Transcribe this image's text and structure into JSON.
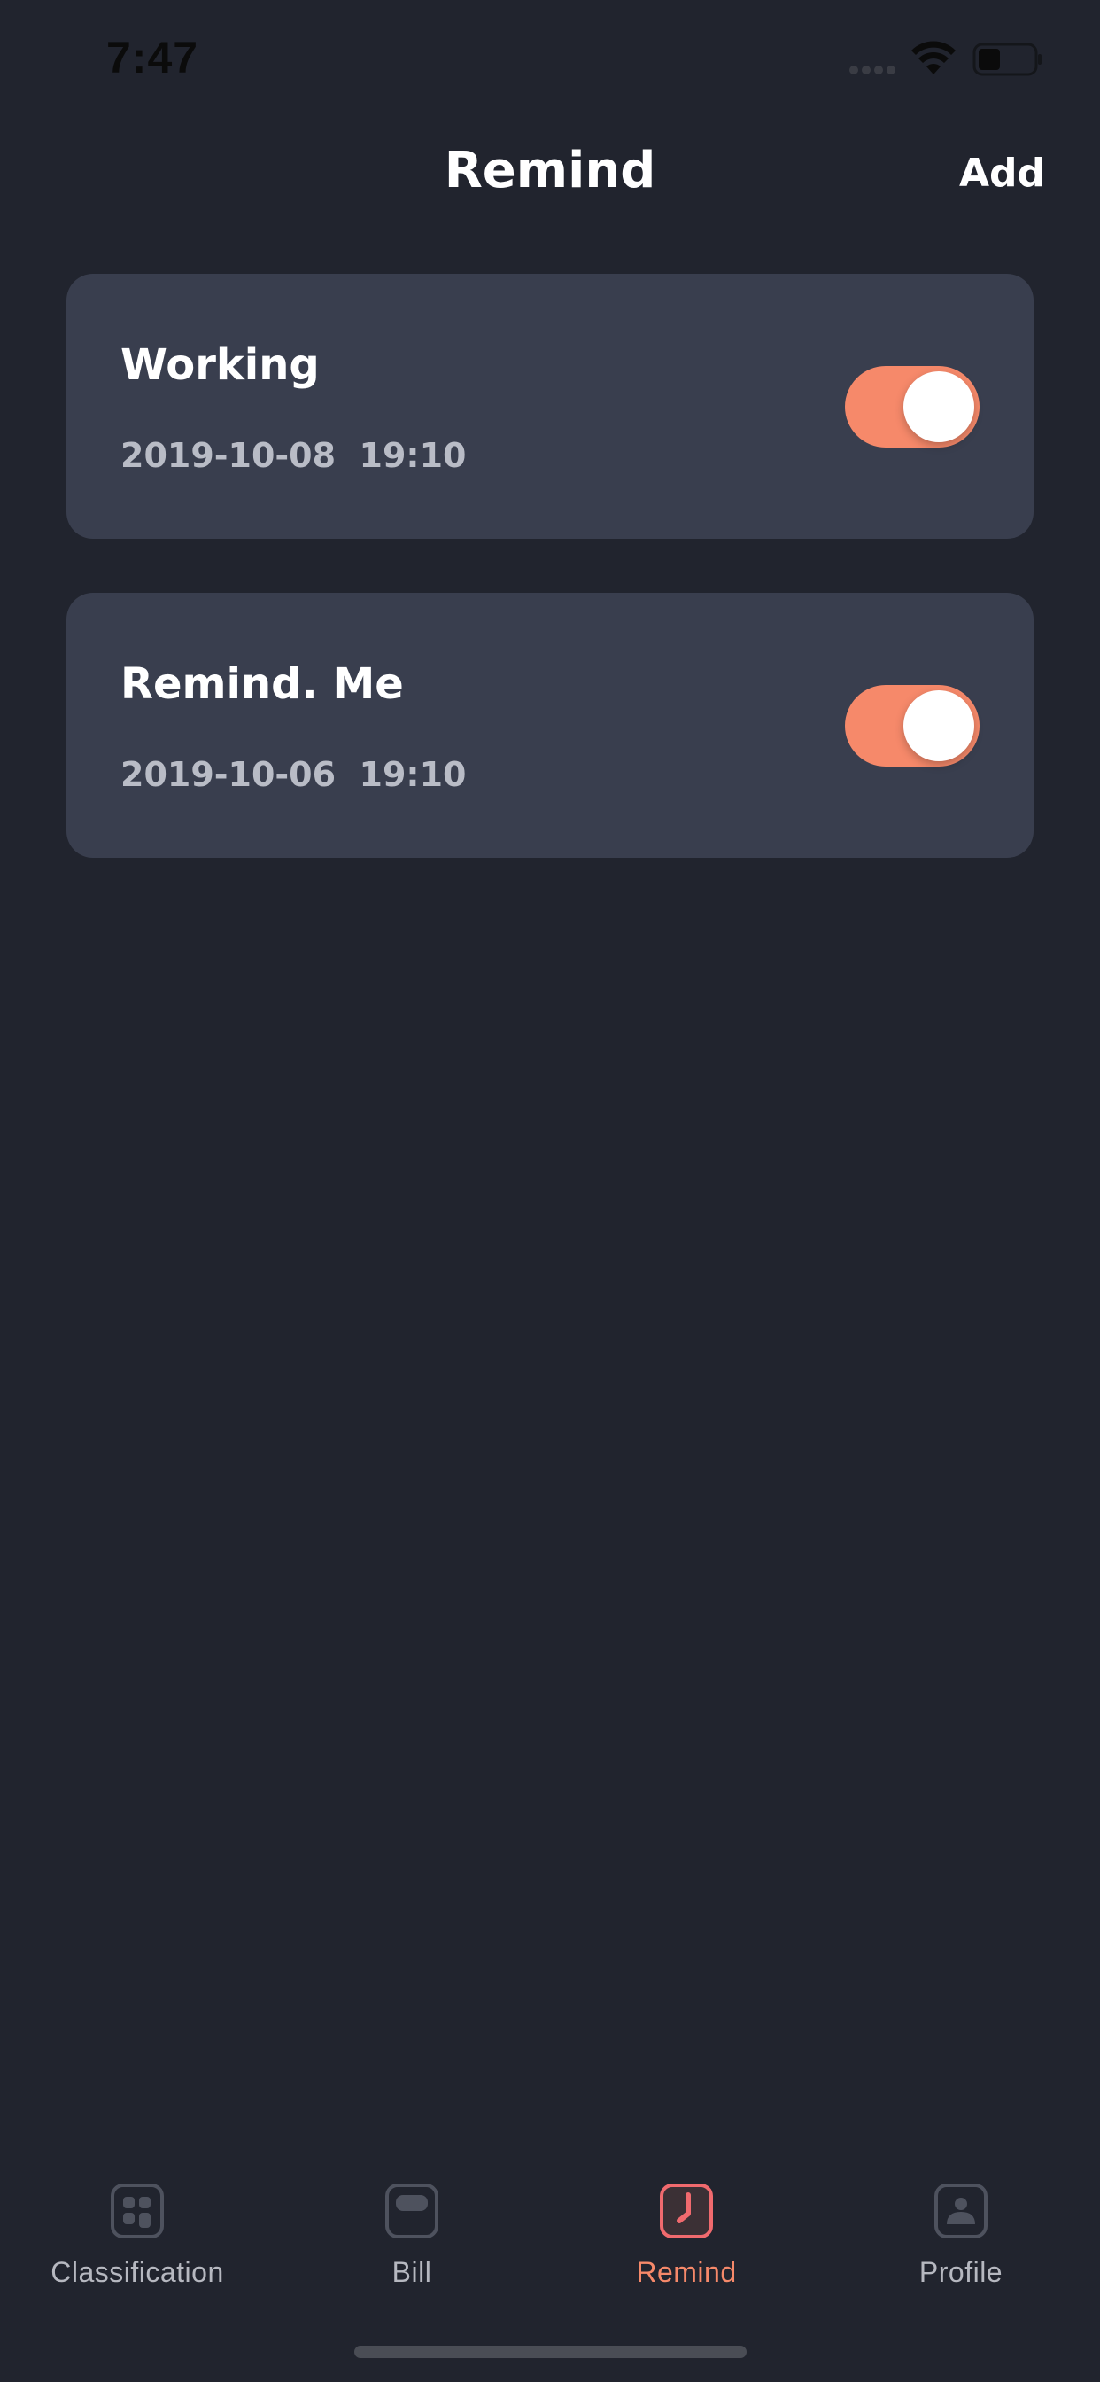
{
  "status_bar": {
    "time": "7:47"
  },
  "header": {
    "title": "Remind",
    "add_label": "Add"
  },
  "reminders": [
    {
      "title": "Working",
      "datetime": "2019-10-08  19:10",
      "enabled": true
    },
    {
      "title": "Remind. Me",
      "datetime": "2019-10-06  19:10",
      "enabled": true
    }
  ],
  "tabs": [
    {
      "label": "Classification",
      "icon": "classification-icon",
      "active": false
    },
    {
      "label": "Bill",
      "icon": "bill-icon",
      "active": false
    },
    {
      "label": "Remind",
      "icon": "clock-icon",
      "active": true
    },
    {
      "label": "Profile",
      "icon": "profile-icon",
      "active": false
    }
  ],
  "colors": {
    "background": "#21242e",
    "card": "#393e4e",
    "accent": "#f6896a",
    "inactive_tab": "#b6b8c0"
  }
}
